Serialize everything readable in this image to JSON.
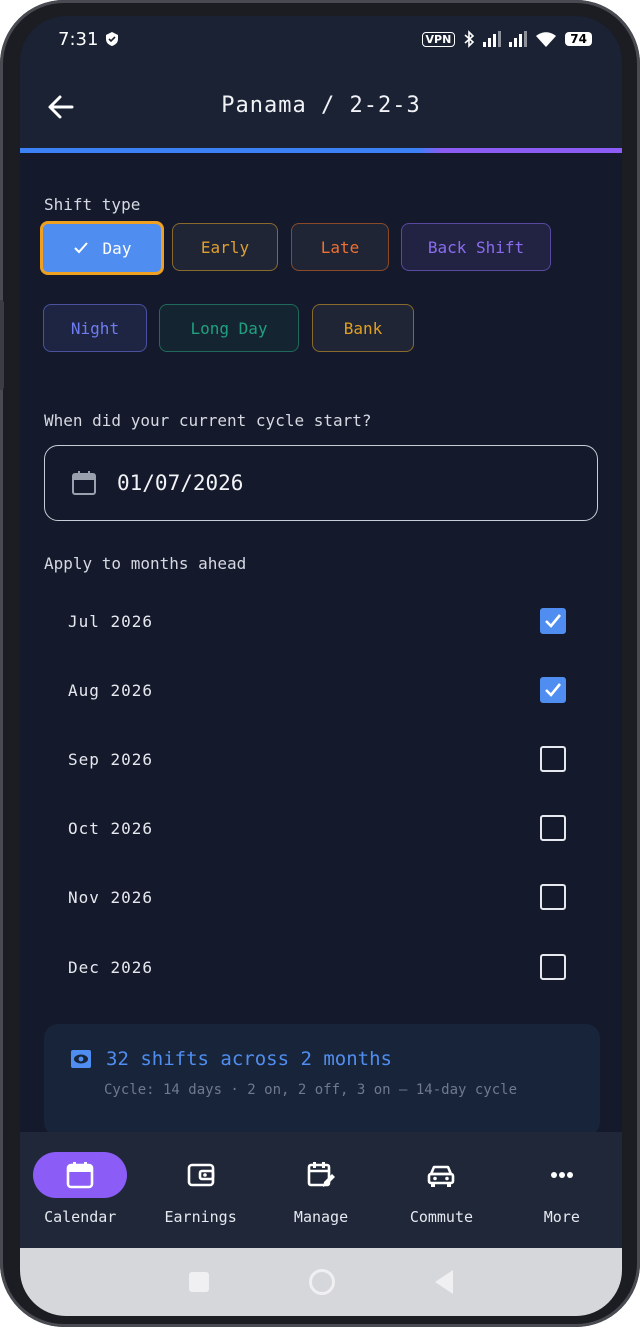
{
  "status_bar": {
    "time": "7:31",
    "vpn": "VPN",
    "battery": "74"
  },
  "app_bar": {
    "title": "Panama / 2-2-3"
  },
  "shift_type": {
    "label": "Shift type",
    "chips": [
      {
        "label": "Day",
        "color": "#4f8ef0",
        "selected": true
      },
      {
        "label": "Early",
        "color": "#e0a030"
      },
      {
        "label": "Late",
        "color": "#f07030"
      },
      {
        "label": "Back Shift",
        "color": "#8b6cf0"
      },
      {
        "label": "Night",
        "color": "#6f7cf0"
      },
      {
        "label": "Long Day",
        "color": "#20a080"
      },
      {
        "label": "Bank",
        "color": "#e0a020"
      }
    ]
  },
  "cycle_start": {
    "label": "When did your current cycle start?",
    "value": "01/07/2026"
  },
  "months_ahead": {
    "label": "Apply to months ahead",
    "months": [
      {
        "label": "Jul 2026",
        "checked": true
      },
      {
        "label": "Aug 2026",
        "checked": true
      },
      {
        "label": "Sep 2026",
        "checked": false
      },
      {
        "label": "Oct 2026",
        "checked": false
      },
      {
        "label": "Nov 2026",
        "checked": false
      },
      {
        "label": "Dec 2026",
        "checked": false
      }
    ]
  },
  "summary": {
    "headline": "32 shifts across 2 months",
    "detail": "Cycle: 14 days · 2 on, 2 off, 3 on — 14-day cycle"
  },
  "nav": {
    "items": [
      {
        "label": "Calendar",
        "icon": "calendar-icon",
        "active": true
      },
      {
        "label": "Earnings",
        "icon": "wallet-icon"
      },
      {
        "label": "Manage",
        "icon": "calendar-edit-icon"
      },
      {
        "label": "Commute",
        "icon": "car-icon"
      },
      {
        "label": "More",
        "icon": "more-icon"
      }
    ]
  },
  "colors": {
    "accent": "#4f8ef0",
    "nav_active": "#8b5cf6",
    "background": "#141a2b"
  }
}
